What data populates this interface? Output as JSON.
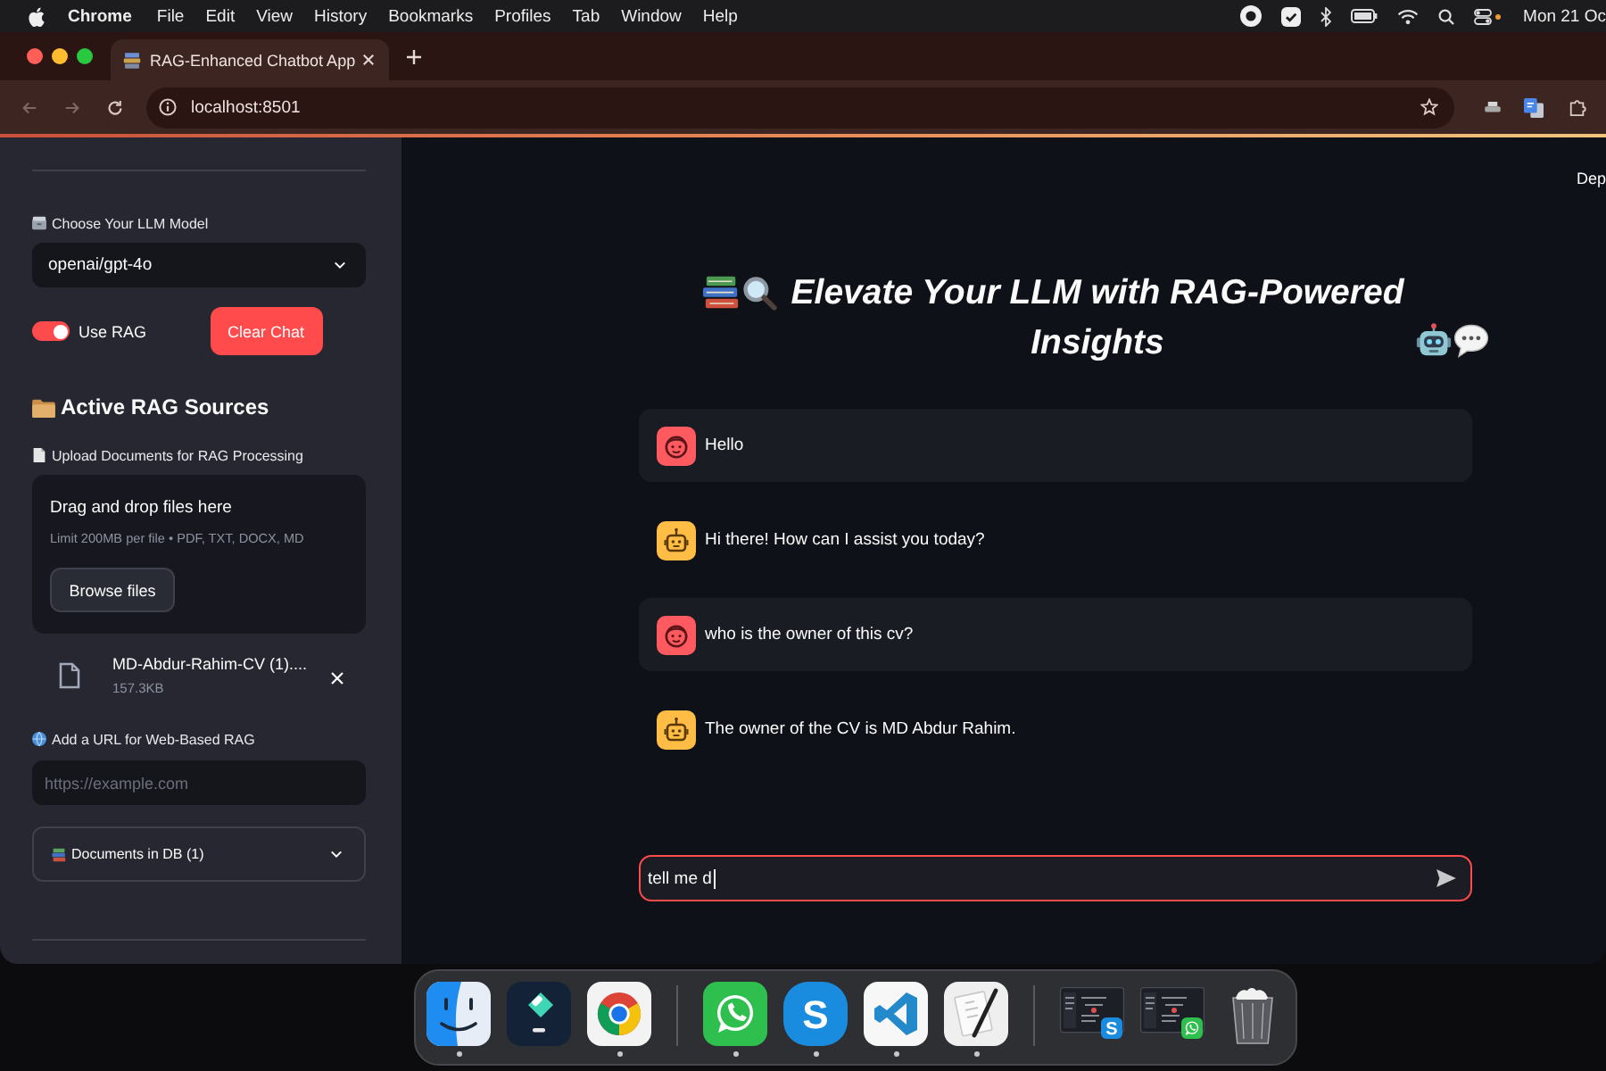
{
  "menu_bar": {
    "app_name": "Chrome",
    "menus": [
      "File",
      "Edit",
      "View",
      "History",
      "Bookmarks",
      "Profiles",
      "Tab",
      "Window",
      "Help"
    ],
    "clock": "Mon 21 Oc"
  },
  "browser": {
    "tabs": [
      {
        "title": "RAG-Enhanced Chatbot App",
        "selected": true
      }
    ],
    "address": "localhost:8501"
  },
  "sidebar": {
    "model_label": "Choose Your LLM Model",
    "model_select": {
      "value": "openai/gpt-4o"
    },
    "use_rag": {
      "label": "Use RAG",
      "on": true
    },
    "clear_button": "Clear Chat",
    "sources_heading": "Active RAG Sources",
    "upload_label": "Upload Documents for RAG Processing",
    "dropzone": {
      "title": "Drag and drop files here",
      "hint": "Limit 200MB per file • PDF, TXT, DOCX, MD",
      "button": "Browse files"
    },
    "files": [
      {
        "name": "MD-Abdur-Rahim-CV (1)....",
        "size": "157.3KB"
      }
    ],
    "url_label": "Add a URL for Web-Based RAG",
    "url_input": {
      "placeholder": "https://example.com"
    },
    "documents_expander": {
      "label": "Documents in DB (1)",
      "expanded": false
    }
  },
  "main": {
    "deploy_button": "Dep",
    "title": "Elevate Your LLM with RAG-Powered Insights",
    "messages": [
      {
        "kind": "user",
        "text": "Hello"
      },
      {
        "kind": "assistant",
        "text": "Hi there! How can I assist you today?"
      },
      {
        "kind": "user",
        "text": "who is the owner of this cv?"
      },
      {
        "kind": "assistant",
        "text": "The owner of the CV is MD Abdur Rahim."
      }
    ],
    "chat_input": {
      "value": "tell me d",
      "focused": true
    }
  },
  "dock": {
    "groups": [
      {
        "items": [
          {
            "kind": "finder",
            "running": true
          },
          {
            "kind": "filmora",
            "running": false
          },
          {
            "kind": "chrome",
            "running": true
          }
        ]
      },
      {
        "items": [
          {
            "kind": "whatsapp",
            "running": true
          },
          {
            "kind": "skype",
            "label": "S",
            "running": true
          },
          {
            "kind": "vscode",
            "running": true
          },
          {
            "kind": "script-editor",
            "running": true
          }
        ]
      },
      {
        "items": [
          {
            "kind": "window-thumbnail",
            "badge": {
              "kind": "skype",
              "label": "S"
            },
            "running": false
          },
          {
            "kind": "window-thumbnail",
            "badge": {
              "kind": "whatsapp"
            },
            "running": false
          },
          {
            "kind": "trash",
            "running": false
          }
        ]
      }
    ]
  }
}
